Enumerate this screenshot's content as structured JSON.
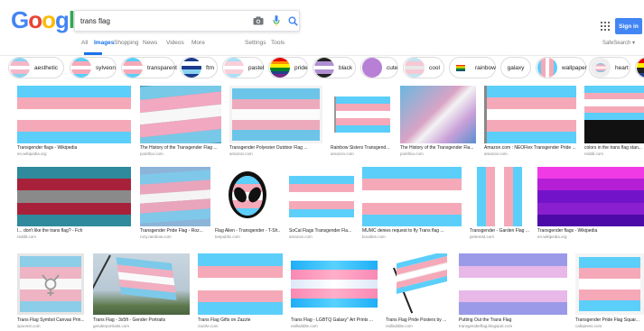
{
  "logo": "Google",
  "search": {
    "query": "trans flag"
  },
  "tabs": [
    {
      "label": "All",
      "active": false
    },
    {
      "label": "Images",
      "active": true
    },
    {
      "label": "Shopping",
      "active": false
    },
    {
      "label": "News",
      "active": false
    },
    {
      "label": "Videos",
      "active": false
    },
    {
      "label": "More",
      "active": false
    }
  ],
  "settings_label": "Settings",
  "tools_label": "Tools",
  "safesearch_label": "SafeSearch ▾",
  "signin_label": "Sign in",
  "colors": {
    "accent": "#1a73e8",
    "signin": "#4285f4",
    "trans_blue": "#5bcefa",
    "trans_pink": "#f5a9b8",
    "white": "#ffffff"
  },
  "chips": [
    {
      "label": "aesthetic",
      "icon": "flag-thumb"
    },
    {
      "label": "sylveon",
      "icon": "flag-thumb"
    },
    {
      "label": "transparent",
      "icon": "flag-thumb"
    },
    {
      "label": "ftm",
      "icon": "flag-thumb"
    },
    {
      "label": "pastel",
      "icon": "flag-thumb"
    },
    {
      "label": "pride",
      "icon": "flag-thumb"
    },
    {
      "label": "black",
      "icon": "flag-thumb"
    },
    {
      "label": "cute",
      "icon": "flag-thumb"
    },
    {
      "label": "cool",
      "icon": "flag-thumb"
    },
    {
      "label": "rainbow",
      "icon": "flag-thumb"
    },
    {
      "label": "galaxy",
      "icon": "flag-thumb"
    },
    {
      "label": "wallpaper",
      "icon": "flag-thumb"
    },
    {
      "label": "heart",
      "icon": "flag-thumb"
    }
  ],
  "results": [
    {
      "title": "Transgender flags - Wikipedia",
      "site": "en.wikipedia.org"
    },
    {
      "title": "The History of the Transgender Flag ...",
      "site": "pointfoo.com"
    },
    {
      "title": "Transgender Polyester Outdoor Flag ...",
      "site": "amazon.com"
    },
    {
      "title": "Rainbow Sisters Transgend...",
      "site": "amazon.com"
    },
    {
      "title": "The History of the Transgender Fla...",
      "site": "pointfoo.com"
    },
    {
      "title": "Amazon.com : NEOFlex Transgender Pride ...",
      "site": "amazon.com"
    },
    {
      "title": "colors in the trans flag stan...",
      "site": "reddit.com"
    },
    {
      "title": "I... don't like the trans flag? - Fch",
      "site": "reddit.com"
    },
    {
      "title": "Transgender Pride Flag - Roz...",
      "site": "rozy.rainbow.com"
    },
    {
      "title": "Flag Alien - Transgender - T-Sh...",
      "site": "teepublic.com"
    },
    {
      "title": "SoCal Flags Transgender Fla...",
      "site": "amazon.com"
    },
    {
      "title": "MUMC denies request to fly Trans flag ...",
      "site": "boodine.com"
    },
    {
      "title": "Transgender - Garden Flag ...",
      "site": "pinterest.com"
    },
    {
      "title": "Transgender flags - Wikipedia",
      "site": "en.wikipedia.org"
    },
    {
      "title": "Trans Flag Symbol Canvas Prin...",
      "site": "spoonst.com"
    },
    {
      "title": "Trans Flag - 3x5ft - Gender Portraits",
      "site": "genderportraits.com"
    },
    {
      "title": "Trans Flag Gifts on Zazzle",
      "site": "zazzle.com"
    },
    {
      "title": "Trans Flag - LGBTQ Galaxy\" Art Prints ...",
      "site": "redbubble.com"
    },
    {
      "title": "Trans Flag Pride Posters by ...",
      "site": "redbubble.com"
    },
    {
      "title": "Putting Out the Trans Flag",
      "site": "transgenderflag.blogspot.com"
    },
    {
      "title": "Transgender Pride Flag Squar...",
      "site": "cafepress.com"
    }
  ]
}
